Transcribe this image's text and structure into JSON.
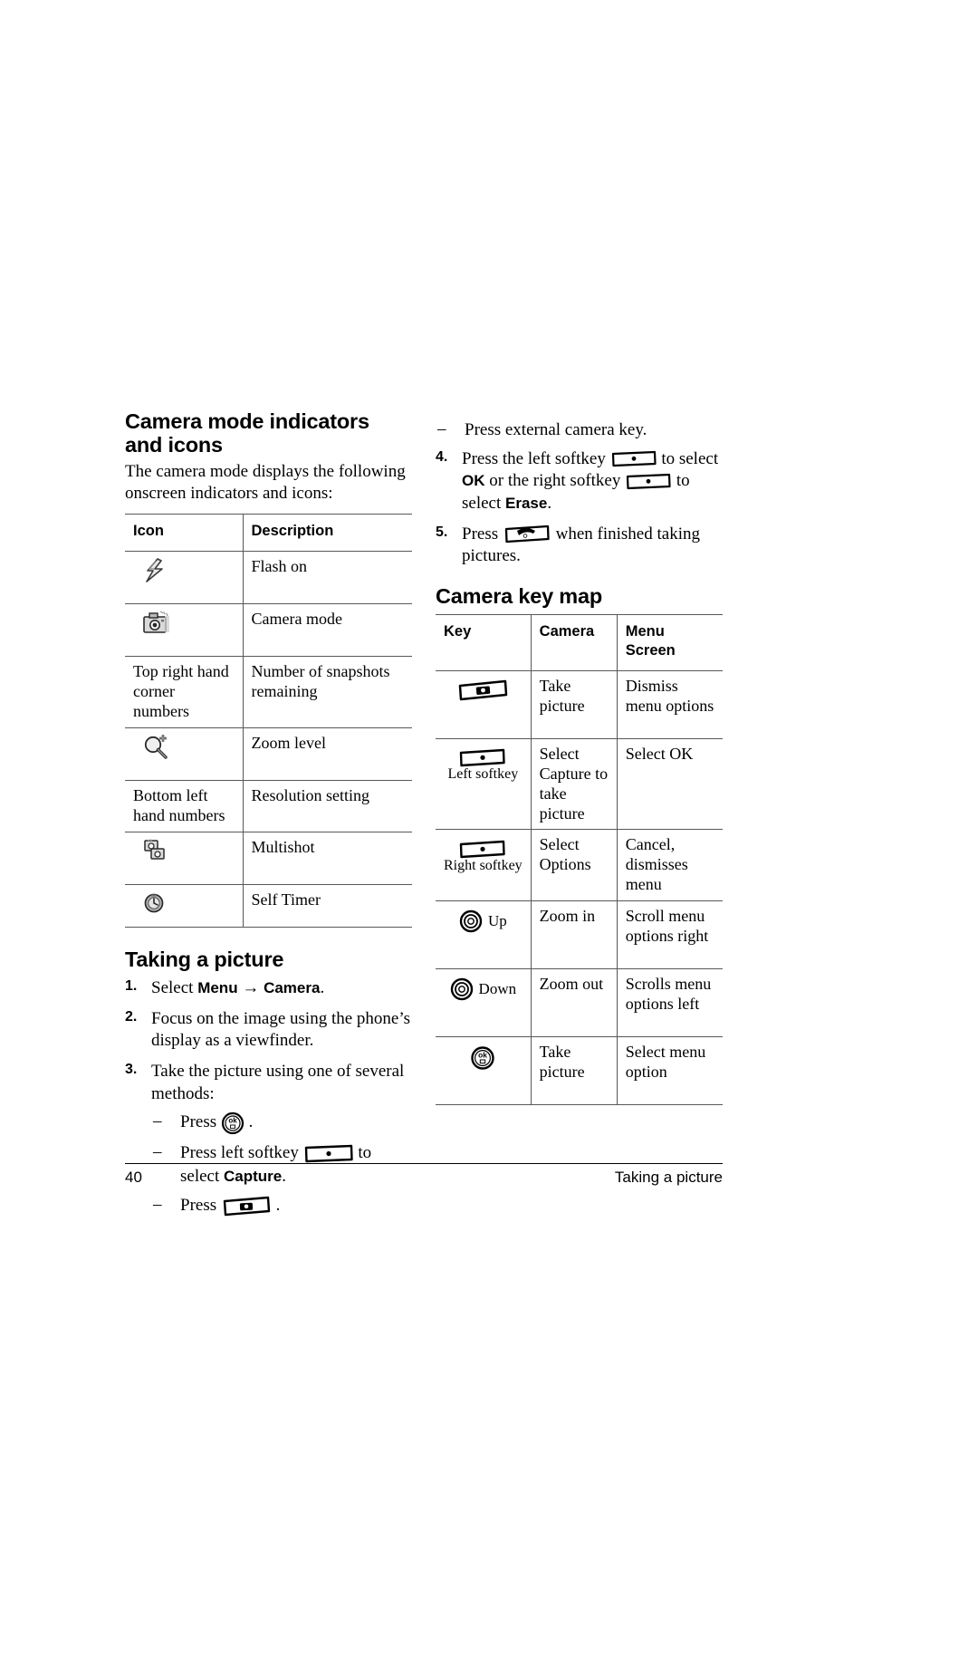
{
  "page": {
    "number": "40",
    "footer_title": "Taking a picture"
  },
  "left_column": {
    "heading": "Camera mode indicators and icons",
    "intro": "The camera mode displays the following onscreen indicators and icons:",
    "icon_table": {
      "headers": [
        "Icon",
        "Description"
      ],
      "rows": [
        {
          "icon": "flash-icon",
          "icon_text": "",
          "description": "Flash on"
        },
        {
          "icon": "camera-mode-icon",
          "icon_text": "",
          "description": "Camera mode"
        },
        {
          "icon": "",
          "icon_text": "Top right hand corner numbers",
          "description": "Number of snapshots remaining"
        },
        {
          "icon": "zoom-icon",
          "icon_text": "",
          "description": "Zoom level"
        },
        {
          "icon": "",
          "icon_text": "Bottom left hand numbers",
          "description": "Resolution setting"
        },
        {
          "icon": "multishot-icon",
          "icon_text": "",
          "description": "Multishot"
        },
        {
          "icon": "self-timer-icon",
          "icon_text": "",
          "description": "Self Timer"
        }
      ]
    },
    "taking_picture": {
      "heading": "Taking a picture",
      "steps": [
        {
          "num": "1.",
          "text_parts": [
            {
              "t": "Select ",
              "bold": false
            },
            {
              "t": "Menu",
              "bold": true
            },
            {
              "t": " → ",
              "bold": false
            },
            {
              "t": "Camera",
              "bold": true
            },
            {
              "t": ".",
              "bold": false
            }
          ],
          "plain": "Select Menu → Camera."
        },
        {
          "num": "2.",
          "plain": "Focus on the image using the phone’s display as a viewfinder."
        },
        {
          "num": "3.",
          "plain": "Take the picture using one of several methods:",
          "substeps": [
            {
              "dash": "–",
              "before": "Press",
              "glyph": "ok-key-icon",
              "after": "."
            },
            {
              "dash": "–",
              "before": "Press left softkey",
              "glyph": "softkey-icon",
              "after": "to select",
              "bold_after": "Capture",
              "tail": "."
            },
            {
              "dash": "–",
              "before": "Press",
              "glyph": "camera-key-icon",
              "after": "."
            }
          ]
        }
      ]
    }
  },
  "right_column": {
    "continued_substep": {
      "dash": "–",
      "text": "Press external camera key."
    },
    "steps": [
      {
        "num": "4.",
        "seg1": "Press the left softkey",
        "glyph1": "softkey-icon",
        "seg2": "to select",
        "bold1": "OK",
        "seg3": "or the right softkey",
        "glyph2": "softkey-icon",
        "seg4": "to select",
        "bold2": "Erase",
        "seg5": "."
      },
      {
        "num": "5.",
        "seg1": "Press",
        "glyph1": "end-key-icon",
        "seg2": "when finished taking pictures."
      }
    ],
    "key_map": {
      "heading": "Camera key map",
      "headers": [
        "Key",
        "Camera",
        "Menu Screen"
      ],
      "rows": [
        {
          "key_icon": "camera-key-icon",
          "key_label": "",
          "camera": "Take picture",
          "menu_screen": "Dismiss menu options"
        },
        {
          "key_icon": "softkey-icon",
          "key_label": "Left softkey",
          "camera": "Select Capture to take picture",
          "menu_screen": "Select OK"
        },
        {
          "key_icon": "softkey-icon",
          "key_label": "Right softkey",
          "camera": "Select Options",
          "menu_screen": "Cancel, dismisses menu"
        },
        {
          "key_icon": "nav-ring-icon",
          "key_label": "Up",
          "camera": "Zoom in",
          "menu_screen": "Scroll menu options right"
        },
        {
          "key_icon": "nav-ring-icon",
          "key_label": "Down",
          "camera": "Zoom out",
          "menu_screen": "Scrolls menu options left"
        },
        {
          "key_icon": "ok-key-icon",
          "key_label": "",
          "camera": "Take picture",
          "menu_screen": "Select menu option"
        }
      ]
    }
  },
  "colors": {
    "text": "#000000",
    "rule": "#58585b",
    "footer_rule": "#000000",
    "icon_gray": "#808080",
    "icon_light": "#c8c8c8"
  }
}
